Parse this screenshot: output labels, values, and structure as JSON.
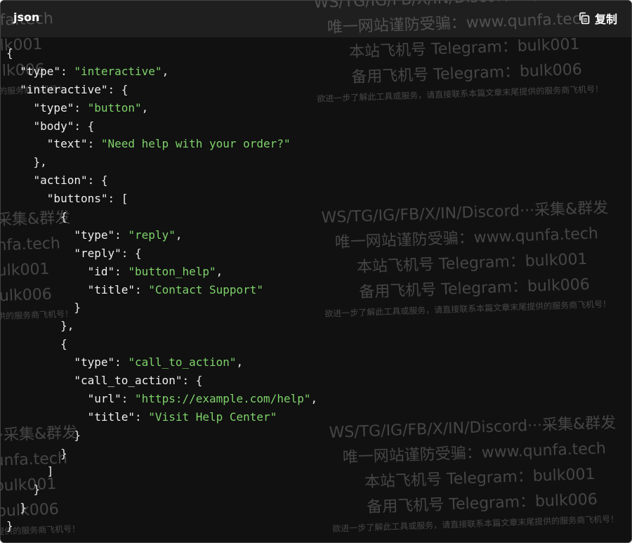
{
  "header": {
    "language": "json",
    "copy_label": "复制",
    "copy_icon": "copy-icon"
  },
  "code_lines": [
    [
      {
        "c": "pun",
        "t": "{"
      }
    ],
    [
      {
        "c": "pun",
        "t": "  "
      },
      {
        "c": "key",
        "t": "\"type\""
      },
      {
        "c": "pun",
        "t": ": "
      },
      {
        "c": "str",
        "t": "\"interactive\""
      },
      {
        "c": "pun",
        "t": ","
      }
    ],
    [
      {
        "c": "pun",
        "t": "  "
      },
      {
        "c": "key",
        "t": "\"interactive\""
      },
      {
        "c": "pun",
        "t": ": {"
      }
    ],
    [
      {
        "c": "pun",
        "t": "    "
      },
      {
        "c": "key",
        "t": "\"type\""
      },
      {
        "c": "pun",
        "t": ": "
      },
      {
        "c": "str",
        "t": "\"button\""
      },
      {
        "c": "pun",
        "t": ","
      }
    ],
    [
      {
        "c": "pun",
        "t": "    "
      },
      {
        "c": "key",
        "t": "\"body\""
      },
      {
        "c": "pun",
        "t": ": {"
      }
    ],
    [
      {
        "c": "pun",
        "t": "      "
      },
      {
        "c": "key",
        "t": "\"text\""
      },
      {
        "c": "pun",
        "t": ": "
      },
      {
        "c": "str",
        "t": "\"Need help with your order?\""
      }
    ],
    [
      {
        "c": "pun",
        "t": "    },"
      }
    ],
    [
      {
        "c": "pun",
        "t": "    "
      },
      {
        "c": "key",
        "t": "\"action\""
      },
      {
        "c": "pun",
        "t": ": {"
      }
    ],
    [
      {
        "c": "pun",
        "t": "      "
      },
      {
        "c": "key",
        "t": "\"buttons\""
      },
      {
        "c": "pun",
        "t": ": ["
      }
    ],
    [
      {
        "c": "pun",
        "t": "        {"
      }
    ],
    [
      {
        "c": "pun",
        "t": "          "
      },
      {
        "c": "key",
        "t": "\"type\""
      },
      {
        "c": "pun",
        "t": ": "
      },
      {
        "c": "str",
        "t": "\"reply\""
      },
      {
        "c": "pun",
        "t": ","
      }
    ],
    [
      {
        "c": "pun",
        "t": "          "
      },
      {
        "c": "key",
        "t": "\"reply\""
      },
      {
        "c": "pun",
        "t": ": {"
      }
    ],
    [
      {
        "c": "pun",
        "t": "            "
      },
      {
        "c": "key",
        "t": "\"id\""
      },
      {
        "c": "pun",
        "t": ": "
      },
      {
        "c": "str",
        "t": "\"button_help\""
      },
      {
        "c": "pun",
        "t": ","
      }
    ],
    [
      {
        "c": "pun",
        "t": "            "
      },
      {
        "c": "key",
        "t": "\"title\""
      },
      {
        "c": "pun",
        "t": ": "
      },
      {
        "c": "str",
        "t": "\"Contact Support\""
      }
    ],
    [
      {
        "c": "pun",
        "t": "          }"
      }
    ],
    [
      {
        "c": "pun",
        "t": "        },"
      }
    ],
    [
      {
        "c": "pun",
        "t": "        {"
      }
    ],
    [
      {
        "c": "pun",
        "t": "          "
      },
      {
        "c": "key",
        "t": "\"type\""
      },
      {
        "c": "pun",
        "t": ": "
      },
      {
        "c": "str",
        "t": "\"call_to_action\""
      },
      {
        "c": "pun",
        "t": ","
      }
    ],
    [
      {
        "c": "pun",
        "t": "          "
      },
      {
        "c": "key",
        "t": "\"call_to_action\""
      },
      {
        "c": "pun",
        "t": ": {"
      }
    ],
    [
      {
        "c": "pun",
        "t": "            "
      },
      {
        "c": "key",
        "t": "\"url\""
      },
      {
        "c": "pun",
        "t": ": "
      },
      {
        "c": "str",
        "t": "\"https://example.com/help\""
      },
      {
        "c": "pun",
        "t": ","
      }
    ],
    [
      {
        "c": "pun",
        "t": "            "
      },
      {
        "c": "key",
        "t": "\"title\""
      },
      {
        "c": "pun",
        "t": ": "
      },
      {
        "c": "str",
        "t": "\"Visit Help Center\""
      }
    ],
    [
      {
        "c": "pun",
        "t": "          }"
      }
    ],
    [
      {
        "c": "pun",
        "t": "        }"
      }
    ],
    [
      {
        "c": "pun",
        "t": "      ]"
      }
    ],
    [
      {
        "c": "pun",
        "t": "    }"
      }
    ],
    [
      {
        "c": "pun",
        "t": "  }"
      }
    ],
    [
      {
        "c": "pun",
        "t": "}"
      }
    ]
  ],
  "watermark": {
    "line1": "WS/TG/IG/FB/X/IN/Discord···采集&群发",
    "line2": "唯一网站谨防受骗：www.qunfa.tech",
    "line3": "本站飞机号 Telegram：bulk001",
    "line4": "备用飞机号 Telegram：bulk006",
    "line5": "欲进一步了解此工具或服务，请直接联系本篇文章末尾提供的服务商飞机号！"
  },
  "colors": {
    "background": "#111111",
    "header": "#1f1f1f",
    "string": "#7fd36b",
    "key": "#f0f0f0"
  }
}
